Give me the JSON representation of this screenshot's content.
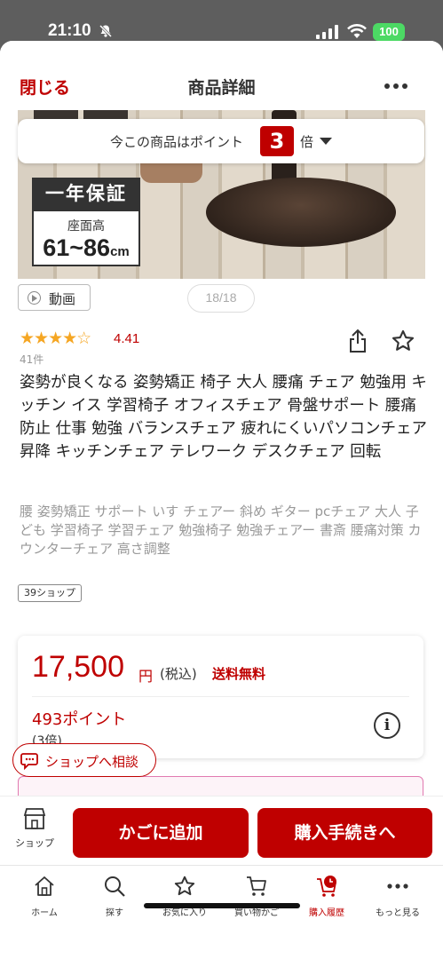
{
  "status_bar": {
    "time": "21:10",
    "battery": "100",
    "icons": [
      "bell-muted-icon",
      "signal-icon",
      "wifi-icon",
      "battery-icon"
    ]
  },
  "header": {
    "close_label": "閉じる",
    "title": "商品詳細",
    "more_icon": "ellipsis-icon"
  },
  "gallery": {
    "points_text_prefix": "今この商品はポイント",
    "points_multiplier": "3",
    "points_text_suffix": "倍",
    "warranty": "一年保証",
    "seat_height_label": "座面高",
    "seat_height_range": "61~86",
    "seat_height_unit": "cm",
    "video_label": "動画",
    "counter": "18/18"
  },
  "product": {
    "rating_stars": "★★★★☆",
    "rating_value": 4.41,
    "rating_score": "4.41",
    "review_count": "41件",
    "title": "姿勢が良くなる 姿勢矯正 椅子 大人 腰痛 チェア 勉強用 キッチン イス 学習椅子 オフィスチェア 骨盤サポート 腰痛防止 仕事 勉強 バランスチェア 疲れにくいパソコンチェア 昇降 キッチンチェア テレワーク デスクチェア 回転",
    "tags": "腰 姿勢矯正 サポート いす チェアー 斜め ギター pcチェア 大人 子ども 学習椅子 学習チェア 勉強椅子 勉強チェアー 書斎 腰痛対策 カウンターチェア 高さ調整",
    "shop_badge": "39ショップ"
  },
  "price": {
    "amount": "17,500",
    "currency": "円",
    "tax": "(税込)",
    "shipping": "送料無料",
    "points": "493ポイント",
    "points_multiplier": "(3倍)",
    "info_icon": "info-icon"
  },
  "consult_label": "ショップへ相談",
  "action_bar": {
    "shop_label": "ショップ",
    "add_to_cart": "かごに追加",
    "checkout": "購入手続きへ"
  },
  "tabs": [
    {
      "label": "ホーム",
      "icon": "home-icon"
    },
    {
      "label": "探す",
      "icon": "search-icon"
    },
    {
      "label": "お気に入り",
      "icon": "star-icon"
    },
    {
      "label": "買い物かご",
      "icon": "cart-icon"
    },
    {
      "label": "購入履歴",
      "icon": "history-icon"
    },
    {
      "label": "もっと見る",
      "icon": "more-icon"
    }
  ],
  "colors": {
    "brand_red": "#bf0000",
    "star_yellow": "#f5a623",
    "battery_green": "#4cd964"
  }
}
